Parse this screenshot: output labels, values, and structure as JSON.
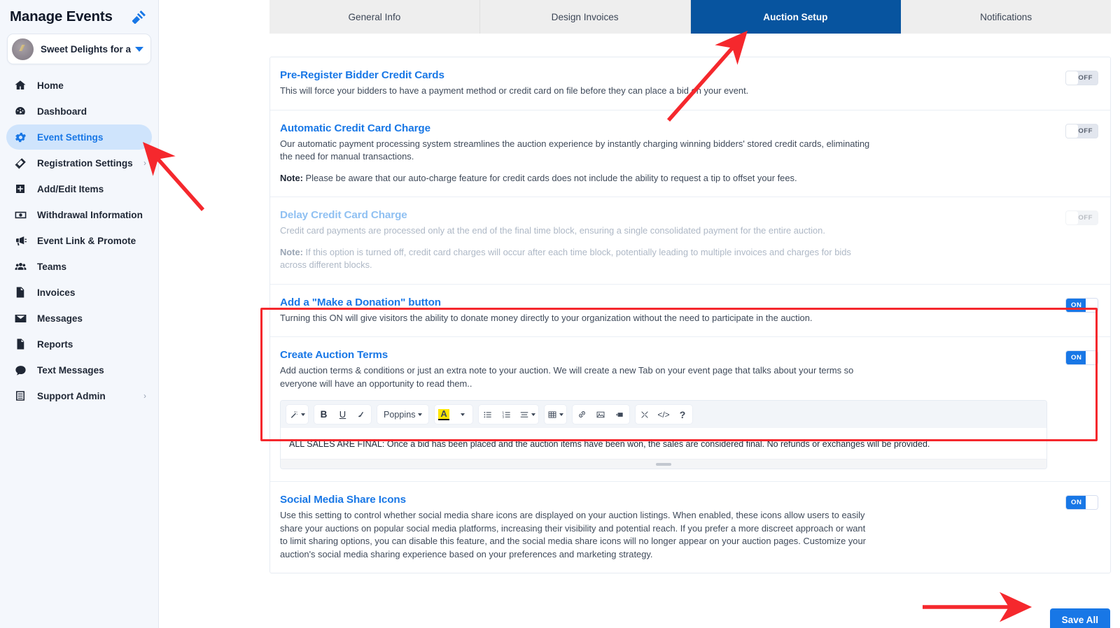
{
  "sidebar": {
    "title": "Manage Events",
    "gavel_icon": "gavel-icon",
    "event_selector": {
      "name": "Sweet Delights for a ...",
      "caret": "chevron-down-icon"
    },
    "items": [
      {
        "label": "Home",
        "icon": "home-icon",
        "active": false,
        "chevron": ""
      },
      {
        "label": "Dashboard",
        "icon": "dashboard-icon",
        "active": false,
        "chevron": ""
      },
      {
        "label": "Event Settings",
        "icon": "gear-icon",
        "active": true,
        "chevron": ""
      },
      {
        "label": "Registration Settings",
        "icon": "ticket-icon",
        "active": false,
        "chevron": "›"
      },
      {
        "label": "Add/Edit Items",
        "icon": "plus-square-icon",
        "active": false,
        "chevron": ""
      },
      {
        "label": "Withdrawal Information",
        "icon": "money-icon",
        "active": false,
        "chevron": ""
      },
      {
        "label": "Event Link & Promote",
        "icon": "megaphone-icon",
        "active": false,
        "chevron": ""
      },
      {
        "label": "Teams",
        "icon": "people-icon",
        "active": false,
        "chevron": ""
      },
      {
        "label": "Invoices",
        "icon": "invoice-icon",
        "active": false,
        "chevron": ""
      },
      {
        "label": "Messages",
        "icon": "envelope-icon",
        "active": false,
        "chevron": ""
      },
      {
        "label": "Reports",
        "icon": "document-icon",
        "active": false,
        "chevron": ""
      },
      {
        "label": "Text Messages",
        "icon": "chat-bubble-icon",
        "active": false,
        "chevron": ""
      },
      {
        "label": "Support Admin",
        "icon": "sliders-icon",
        "active": false,
        "chevron": "›"
      }
    ]
  },
  "tabs": [
    {
      "label": "General Info",
      "active": false
    },
    {
      "label": "Design Invoices",
      "active": false
    },
    {
      "label": "Auction Setup",
      "active": true
    },
    {
      "label": "Notifications",
      "active": false
    }
  ],
  "settings": [
    {
      "title": "Pre-Register Bidder Credit Cards",
      "desc": "This will force your bidders to have a payment method or credit card on file before they can place a bid on your event.",
      "note_label": "",
      "note": "",
      "toggle": "OFF",
      "disabled": false
    },
    {
      "title": "Automatic Credit Card Charge",
      "desc": "Our automatic payment processing system streamlines the auction experience by instantly charging winning bidders' stored credit cards, eliminating the need for manual transactions.",
      "note_label": "Note:",
      "note": " Please be aware that our auto-charge feature for credit cards does not include the ability to request a tip to offset your fees.",
      "toggle": "OFF",
      "disabled": false
    },
    {
      "title": "Delay Credit Card Charge",
      "desc": "Credit card payments are processed only at the end of the final time block, ensuring a single consolidated payment for the entire auction.",
      "note_label": "Note:",
      "note": " If this option is turned off, credit card charges will occur after each time block, potentially leading to multiple invoices and charges for bids across different blocks.",
      "toggle": "OFF",
      "disabled": true
    },
    {
      "title": "Add a \"Make a Donation\" button",
      "desc": "Turning this ON will give visitors the ability to donate money directly to your organization without the need to participate in the auction.",
      "note_label": "",
      "note": "",
      "toggle": "ON",
      "disabled": false
    },
    {
      "title": "Create Auction Terms",
      "desc": "Add auction terms & conditions or just an extra note to your auction.  We will create a new Tab on your event page that talks about your terms so everyone will have an opportunity to read them..",
      "note_label": "",
      "note": "",
      "toggle": "ON",
      "disabled": false
    },
    {
      "title": "Social Media Share Icons",
      "desc": "Use this setting to control whether social media share icons are displayed on your auction listings. When enabled, these icons allow users to easily share your auctions on popular social media platforms, increasing their visibility and potential reach. If you prefer a more discreet approach or want to limit sharing options, you can disable this feature, and the social media share icons will no longer appear on your auction pages. Customize your auction's social media sharing experience based on your preferences and marketing strategy.",
      "note_label": "",
      "note": "",
      "toggle": "ON",
      "disabled": false
    }
  ],
  "editor": {
    "font_name": "Poppins",
    "content": "ALL SALES ARE FINAL: Once a bid has been placed and the auction items have been won, the sales are considered final. No refunds or exchanges will be provided.",
    "toolbar": [
      {
        "icon": "magic-wand-icon",
        "glyph": "✨",
        "caret": true
      },
      {
        "icon": "bold-icon",
        "glyph": "B",
        "caret": false
      },
      {
        "icon": "underline-icon",
        "glyph": "U",
        "caret": false
      },
      {
        "icon": "clear-format-icon",
        "glyph": "◧",
        "caret": false
      },
      {
        "icon": "font-family-select",
        "glyph": "Poppins",
        "caret": true
      },
      {
        "icon": "text-highlight-icon",
        "glyph": "A",
        "caret": false
      },
      {
        "icon": "color-dropdown-icon",
        "glyph": "",
        "caret": true
      },
      {
        "icon": "bullet-list-icon",
        "glyph": "☰",
        "caret": false
      },
      {
        "icon": "numbered-list-icon",
        "glyph": "☰",
        "caret": false
      },
      {
        "icon": "align-icon",
        "glyph": "≡",
        "caret": true
      },
      {
        "icon": "table-icon",
        "glyph": "⊞",
        "caret": true
      },
      {
        "icon": "link-icon",
        "glyph": "⚭",
        "caret": false
      },
      {
        "icon": "image-icon",
        "glyph": "Ὓc",
        "caret": false
      },
      {
        "icon": "video-icon",
        "glyph": "▶",
        "caret": false
      },
      {
        "icon": "fullscreen-icon",
        "glyph": "⤢",
        "caret": false
      },
      {
        "icon": "code-view-icon",
        "glyph": "</>",
        "caret": false
      },
      {
        "icon": "help-icon",
        "glyph": "?",
        "caret": false
      }
    ]
  },
  "footer": {
    "save_label": "Save All"
  },
  "colors": {
    "accent_blue": "#1877e6",
    "active_tab_blue": "#07549f",
    "annotation_red": "#f5282d",
    "sidebar_bg": "#f4f7fc",
    "toggle_on": "#1877e6",
    "highlight_yellow": "#ffe600"
  }
}
